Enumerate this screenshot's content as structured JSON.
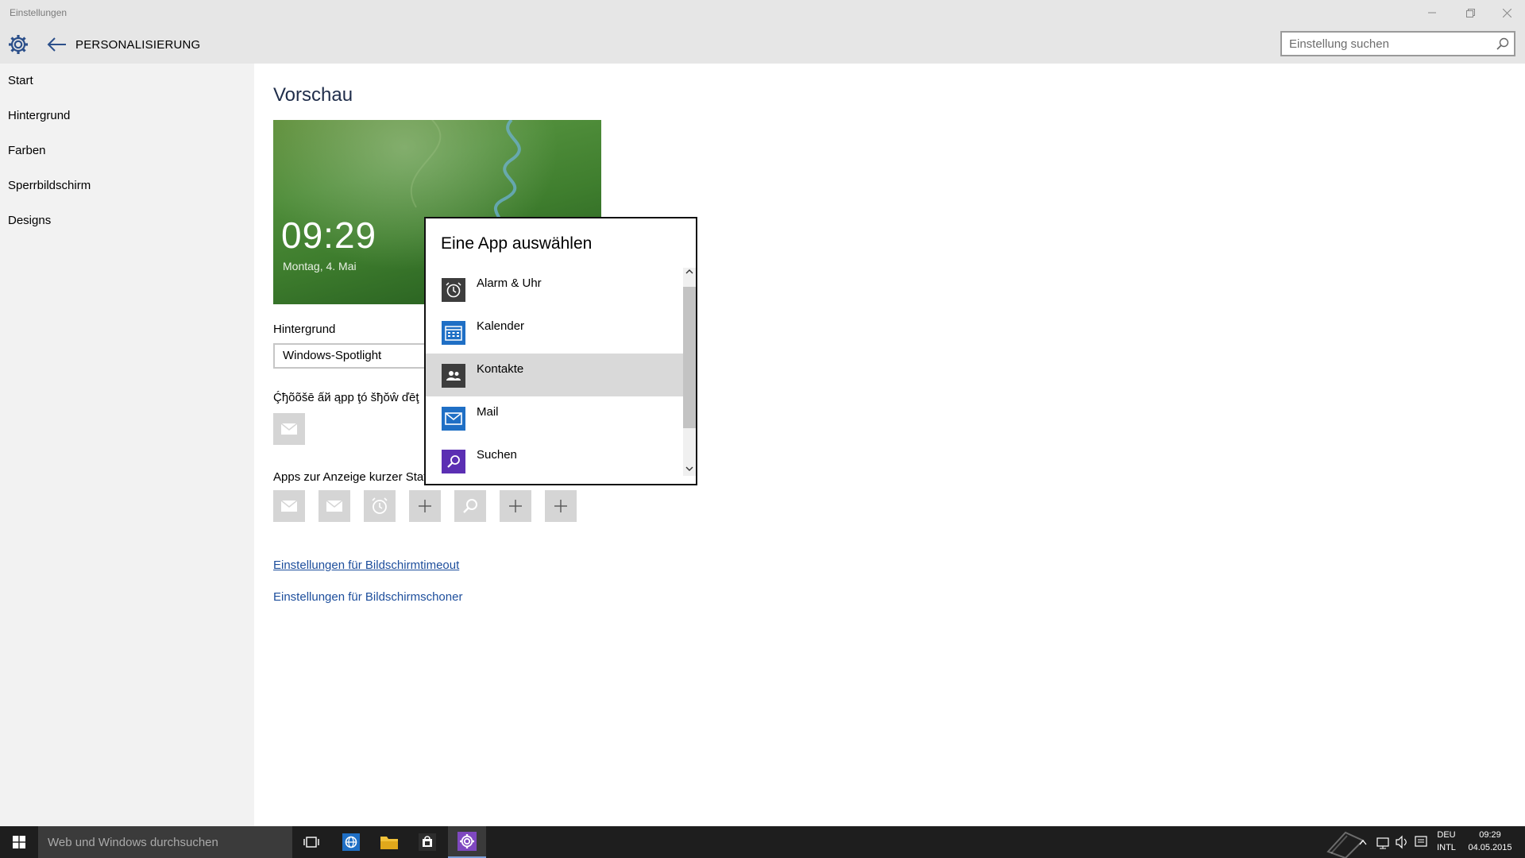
{
  "window": {
    "title": "Einstellungen",
    "controls": [
      "minimize-icon",
      "restore-icon",
      "close-icon"
    ]
  },
  "header": {
    "title": "PERSONALISIERUNG",
    "search_placeholder": "Einstellung suchen"
  },
  "sidebar": {
    "items": [
      {
        "label": "Start"
      },
      {
        "label": "Hintergrund"
      },
      {
        "label": "Farben"
      },
      {
        "label": "Sperrbildschirm"
      },
      {
        "label": "Designs"
      }
    ]
  },
  "main": {
    "preview_heading": "Vorschau",
    "preview": {
      "time": "09:29",
      "date": "Montag, 4. Mai"
    },
    "background_label": "Hintergrund",
    "background_value": "Windows-Spotlight",
    "detailed_status_label": "Ḉђõõšē ấй ąрр ţó šђŏŵ ďēţ",
    "detailed_status_app": "mail-icon",
    "quick_status_label": "Apps zur Anzeige kurzer Stat",
    "quick_status_apps": [
      "mail-icon",
      "mail-icon",
      "alarm-icon",
      "plus-icon",
      "search-icon",
      "plus-icon",
      "plus-icon"
    ],
    "link_timeout": "Einstellungen für Bildschirmtimeout",
    "link_screensaver": "Einstellungen für Bildschirmschoner"
  },
  "flyout": {
    "title": "Eine App auswählen",
    "apps": [
      {
        "name": "Alarm & Uhr",
        "icon": "alarm-icon",
        "color": "#3d3d3d",
        "selected": false
      },
      {
        "name": "Kalender",
        "icon": "calendar-icon",
        "color": "#1f6fc5",
        "selected": false
      },
      {
        "name": "Kontakte",
        "icon": "people-icon",
        "color": "#3d3d3d",
        "selected": true
      },
      {
        "name": "Mail",
        "icon": "mail-icon",
        "color": "#1f6fc5",
        "selected": false
      },
      {
        "name": "Suchen",
        "icon": "search-icon",
        "color": "#5b2fb3",
        "selected": false
      }
    ]
  },
  "taskbar": {
    "search_placeholder": "Web und Windows durchsuchen",
    "pinned": [
      "task-view-icon",
      "edge-icon",
      "file-explorer-icon",
      "store-icon",
      "settings-icon"
    ],
    "language_top": "DEU",
    "language_bottom": "INTL",
    "clock_time": "09:29",
    "clock_date": "04.05.2015"
  },
  "colors": {
    "accent": "#7f48c0",
    "link": "#1d4e9c",
    "chrome": "#e6e6e6",
    "sidebar": "#f2f2f2",
    "taskbar": "#1e1e1e"
  }
}
